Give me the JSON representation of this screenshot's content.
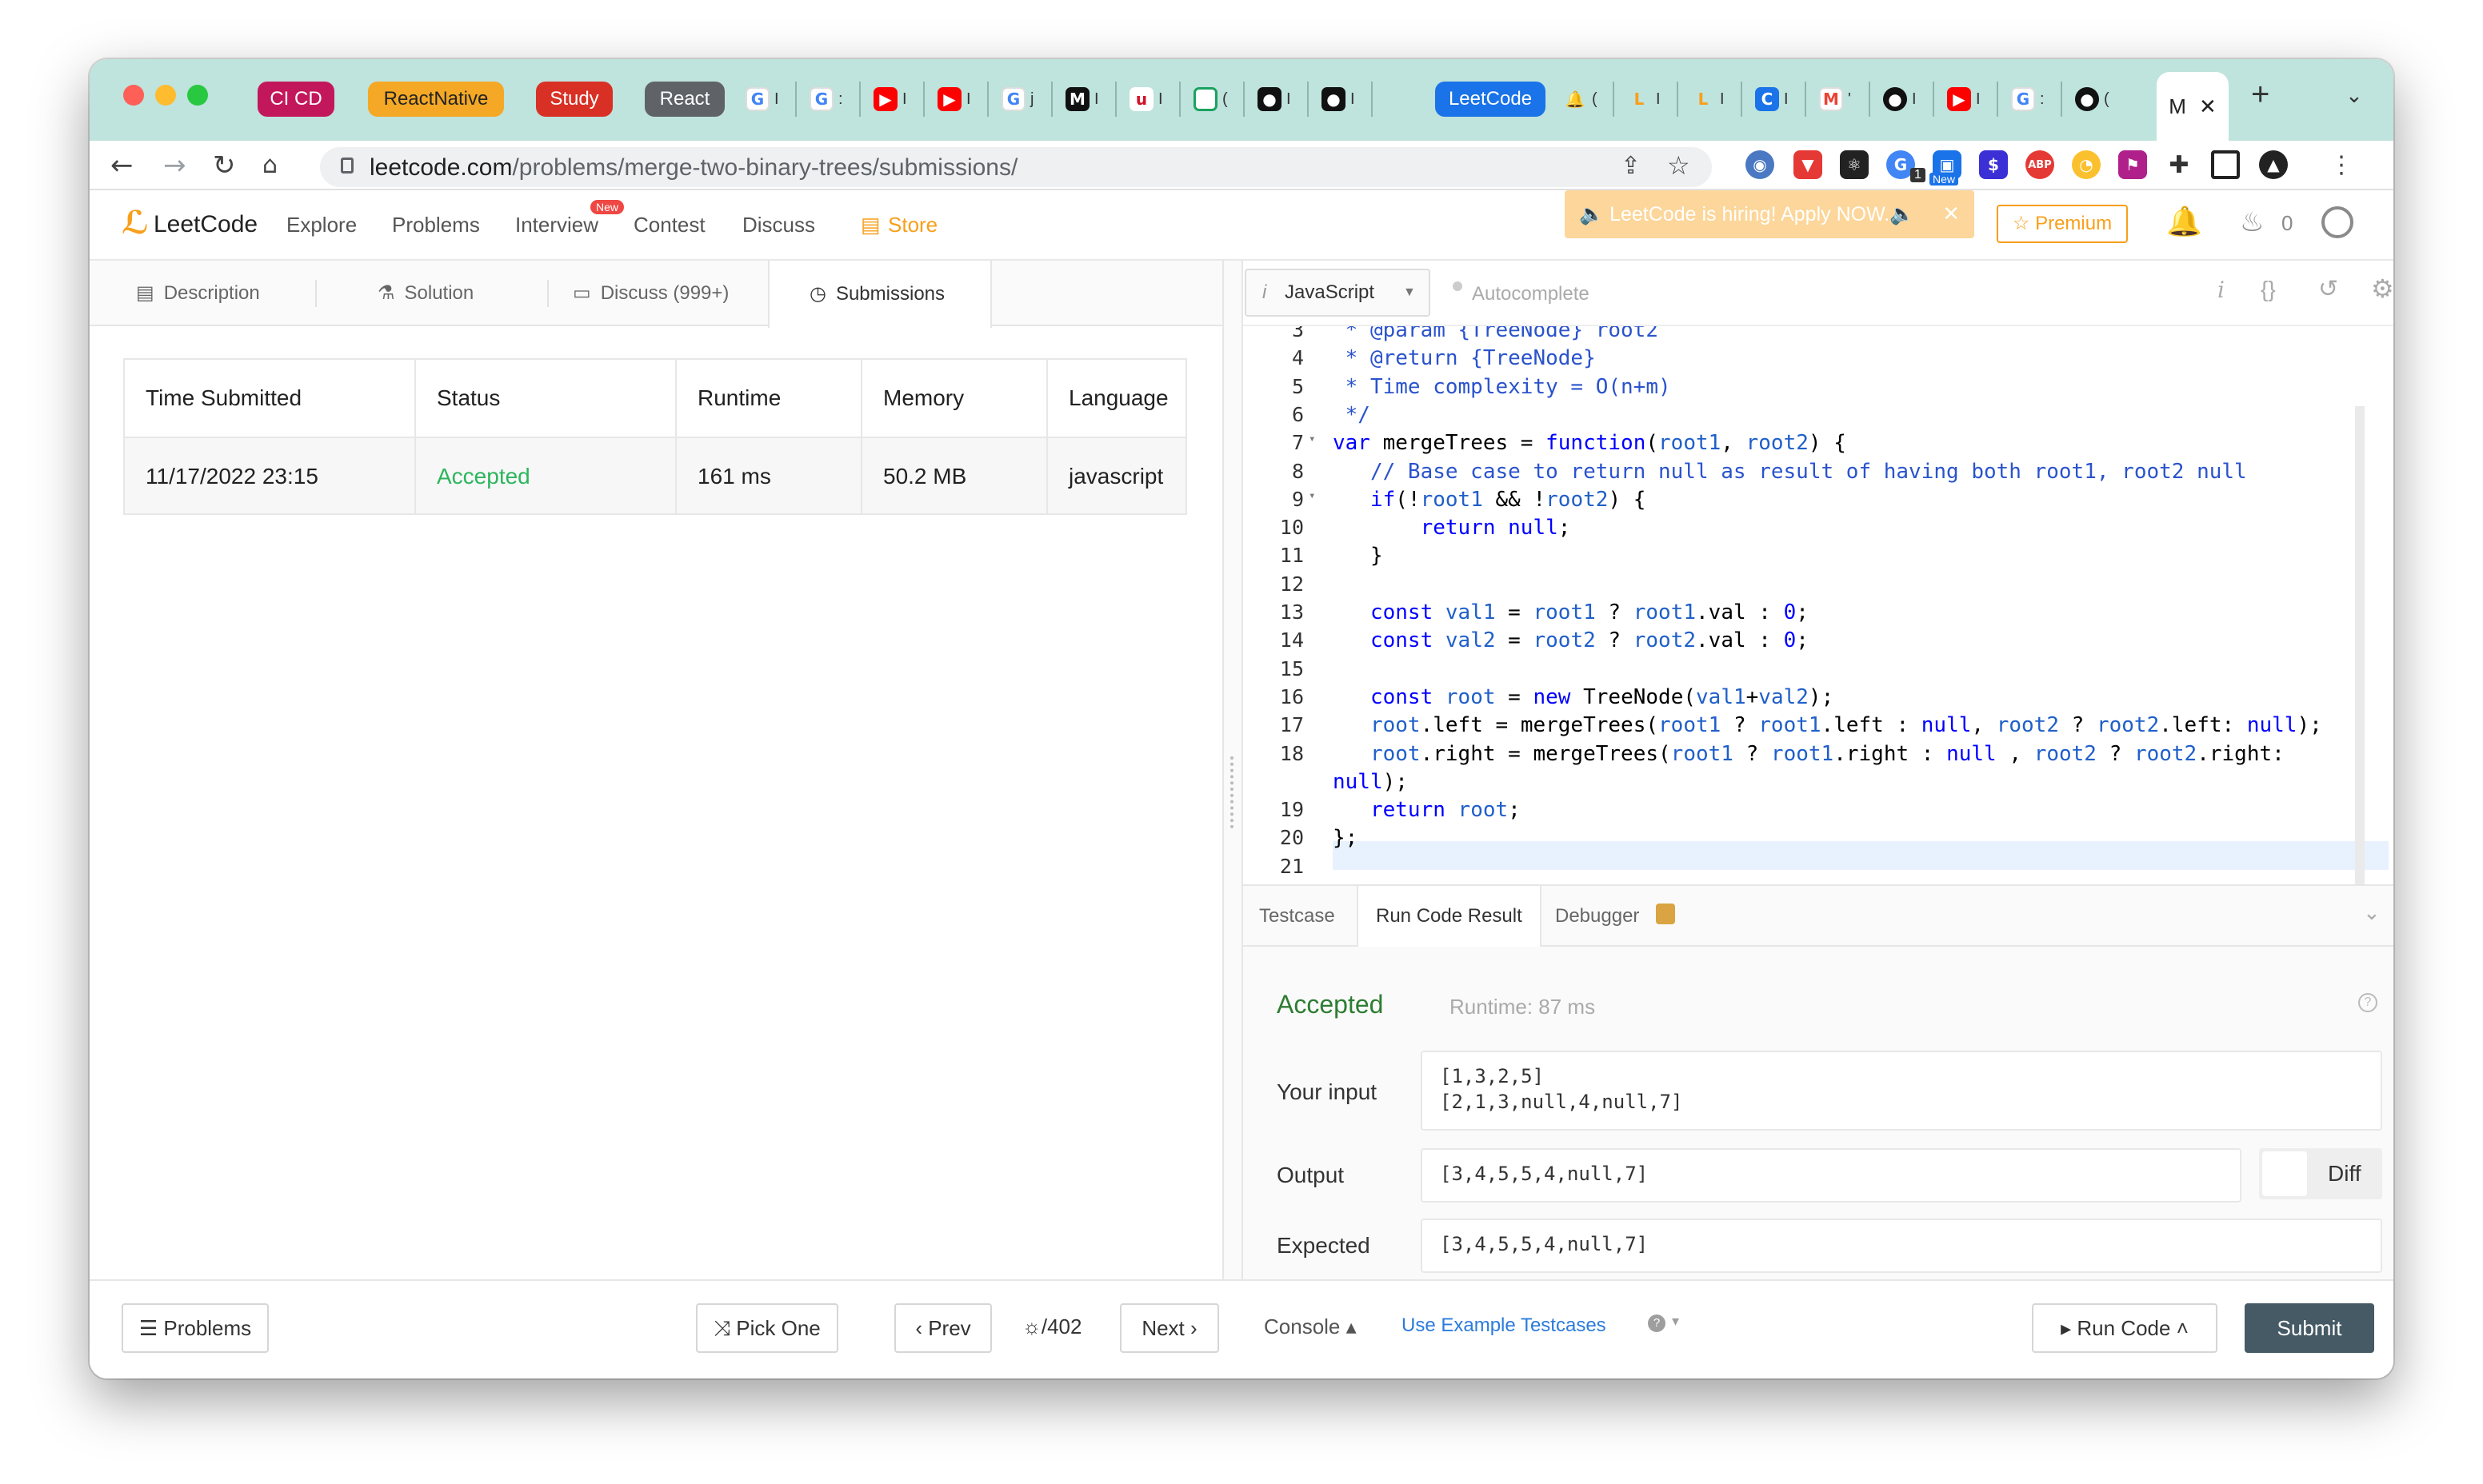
{
  "browser": {
    "tab_groups": [
      {
        "label": "CI CD",
        "color": "#c2185b"
      },
      {
        "label": "ReactNative",
        "color": "#f4a825"
      },
      {
        "label": "Study",
        "color": "#d93025"
      },
      {
        "label": "React",
        "color": "#5f6368"
      }
    ],
    "leetcode_group_label": "LeetCode",
    "active_tab_title": "M",
    "new_tab_symbol": "+",
    "url_host": "leetcode.com",
    "url_path": "/problems/merge-two-binary-trees/submissions/",
    "extension_badges": {
      "count": "1",
      "new": "New"
    }
  },
  "header": {
    "logo_text": "LeetCode",
    "nav": [
      "Explore",
      "Problems",
      "Interview",
      "Contest",
      "Discuss",
      "Store"
    ],
    "new_badge": "New",
    "hiring_banner": "🔈 LeetCode is hiring! Apply NOW.🔈",
    "premium_label": "Premium",
    "streak_count": "0"
  },
  "panel_tabs": [
    "Description",
    "Solution",
    "Discuss (999+)",
    "Submissions"
  ],
  "submissions": {
    "columns": [
      "Time Submitted",
      "Status",
      "Runtime",
      "Memory",
      "Language"
    ],
    "rows": [
      [
        "11/17/2022 23:15",
        "Accepted",
        "161 ms",
        "50.2 MB",
        "javascript"
      ]
    ]
  },
  "editor": {
    "language": "JavaScript",
    "autocomplete": "Autocomplete",
    "line_numbers": [
      "3",
      "4",
      "5",
      "6",
      "7",
      "8",
      "9",
      "10",
      "11",
      "12",
      "13",
      "14",
      "15",
      "16",
      "17",
      "18",
      "",
      "19",
      "20",
      "21"
    ],
    "code_lines": [
      " * @param {TreeNode} root2",
      " * @return {TreeNode}",
      " * Time complexity = O(n+m)",
      " */",
      "var mergeTrees = function(root1, root2) {",
      "   // Base case to return null as result of having both root1, root2 null",
      "   if(!root1 && !root2) {",
      "       return null;",
      "   }",
      "",
      "   const val1 = root1 ? root1.val : 0;",
      "   const val2 = root2 ? root2.val : 0;",
      "",
      "   const root = new TreeNode(val1+val2);",
      "   root.left = mergeTrees(root1 ? root1.left : null, root2 ? root2.left: null);",
      "   root.right = mergeTrees(root1 ? root1.right : null , root2 ? root2.right:",
      "null);",
      "   return root;",
      "};",
      ""
    ]
  },
  "result_tabs": [
    "Testcase",
    "Run Code Result",
    "Debugger"
  ],
  "result": {
    "status": "Accepted",
    "runtime": "Runtime: 87 ms",
    "your_input_label": "Your input",
    "your_input": [
      "[1,3,2,5]",
      "[2,1,3,null,4,null,7]"
    ],
    "output_label": "Output",
    "output": "[3,4,5,5,4,null,7]",
    "diff_label": "Diff",
    "expected_label": "Expected",
    "expected": "[3,4,5,5,4,null,7]"
  },
  "bottom_bar": {
    "problems": "Problems",
    "pick_one": "Pick One",
    "prev": "Prev",
    "counter": "/402",
    "next": "Next",
    "console": "Console",
    "use_example": "Use Example Testcases",
    "run_code": "Run Code",
    "submit": "Submit"
  },
  "colors": {
    "accepted": "#2e7d32",
    "accepted_table": "#2db55d",
    "link": "#2a7bdc",
    "submit_bg": "#455a64",
    "hiring_bg": "#fcd69a"
  }
}
